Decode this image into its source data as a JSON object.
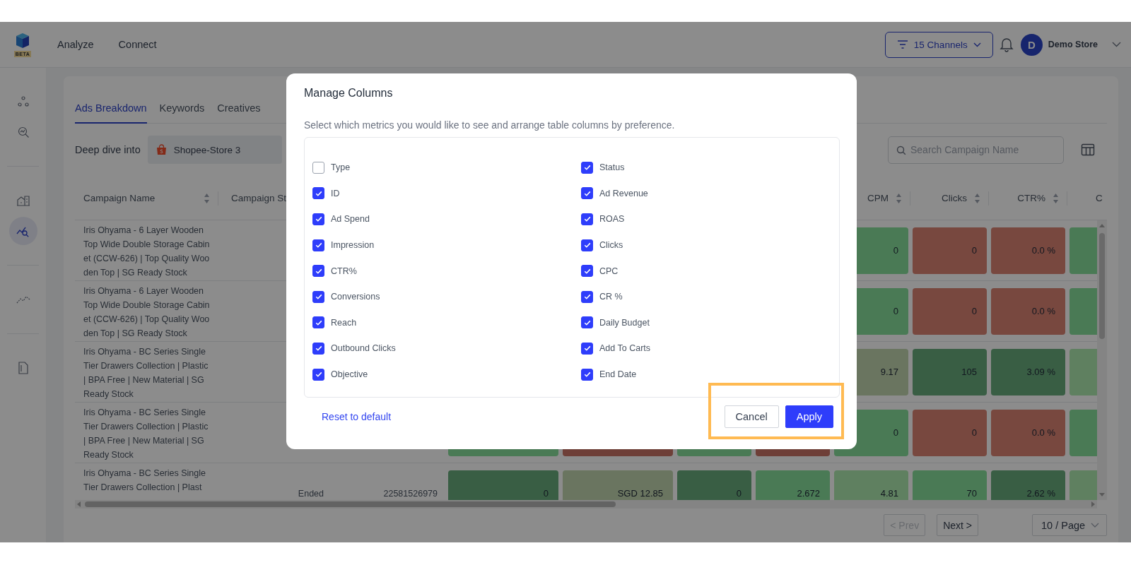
{
  "top_bar": {
    "logo_badge": "BETA",
    "nav": [
      {
        "label": "Analyze"
      },
      {
        "label": "Connect"
      }
    ],
    "channels_button": "15 Channels",
    "user": {
      "avatar": "D",
      "name": "Demo Store"
    }
  },
  "sidebar": {
    "groups": [
      {
        "items": [
          {
            "selected": false
          },
          {
            "selected": false
          }
        ]
      },
      {
        "items": [
          {
            "selected": false
          },
          {
            "selected": true
          }
        ]
      },
      {
        "items": [
          {
            "selected": false
          }
        ]
      },
      {
        "items": [
          {
            "selected": false
          }
        ]
      }
    ]
  },
  "tabs": [
    {
      "label": "Ads Breakdown",
      "selected": true
    },
    {
      "label": "Keywords",
      "selected": false
    },
    {
      "label": "Creatives",
      "selected": false
    }
  ],
  "filters": {
    "label": "Deep dive into",
    "store": "Shopee-Store 3",
    "search": {
      "placeholder": "Search Campaign Name"
    }
  },
  "table": {
    "columns": [
      "Campaign Name",
      "Campaign St",
      null,
      null,
      null,
      null,
      null,
      "CPM",
      "Clicks",
      "CTR%",
      "C"
    ],
    "rows": [
      {
        "name": "Iris Ohyama - 6 Layer Wooden Top Wide Double Storage Cabinet (CCW-626) | Top Quality Wooden Top | SG Ready Stock",
        "cells": [
          null,
          null,
          null,
          null,
          {
            "value": "0",
            "color": "#4a7a56"
          },
          {
            "value": "0",
            "color": "#784840"
          },
          {
            "value": "0.0 %",
            "color": "#784840"
          },
          {
            "color": "#4a7a56"
          }
        ]
      },
      {
        "name": "Iris Ohyama - 6 Layer Wooden Top Wide Double Storage Cabinet (CCW-626) | Top Quality Wooden Top | SG Ready Stock",
        "cells": [
          null,
          null,
          null,
          null,
          {
            "value": "0",
            "color": "#4a7a56"
          },
          {
            "value": "0",
            "color": "#784840"
          },
          {
            "value": "0.0 %",
            "color": "#784840"
          },
          {
            "color": "#4a7a56"
          }
        ]
      },
      {
        "name": "Iris Ohyama - BC Series Single Tier Drawers Collection | Plastic | BPA Free | New Material | SG Ready Stock",
        "cells": [
          null,
          null,
          null,
          null,
          {
            "value": "9.17",
            "color": "#6a7560"
          },
          {
            "value": "105",
            "color": "#3a5e45"
          },
          {
            "value": "3.09 %",
            "color": "#3a5e45"
          },
          {
            "color": "#5f8060"
          }
        ]
      },
      {
        "name": "Iris Ohyama - BC Series Single Tier Drawers Collection | Plastic | BPA Free | New Material | SG Ready Stock",
        "cells": [
          {
            "color": "#4a7a56"
          },
          {
            "color": "#6e3f38"
          },
          {
            "color": "#4a7a56"
          },
          {
            "color": "#6e3f38"
          },
          {
            "value": "0",
            "color": "#4a7a56"
          },
          {
            "value": "0",
            "color": "#784840"
          },
          {
            "value": "0.0 %",
            "color": "#784840"
          },
          {
            "color": "#4a7a56"
          }
        ]
      },
      {
        "name": "Iris Ohyama - BC Series Single Tier Drawers Collection | Plast",
        "status": "Ended",
        "id": "22581526979",
        "cells": [
          {
            "value": "0",
            "color": "#3a5e45"
          },
          {
            "value": "SGD 12.85",
            "color": "#6a7560"
          },
          {
            "value": "0",
            "color": "#3a5e45"
          },
          {
            "value": "2.672",
            "color": "#4a7a56"
          },
          {
            "value": "4.81",
            "color": "#5f8060"
          },
          {
            "value": "70",
            "color": "#4a7a56"
          },
          {
            "value": "2.62 %",
            "color": "#3a5e45"
          },
          {
            "color": "#5f8060"
          }
        ]
      }
    ]
  },
  "pagination": {
    "prev": {
      "label": "< Prev",
      "disabled": true
    },
    "next": {
      "label": "Next >",
      "disabled": false
    },
    "page_size": "10 / Page"
  },
  "dialog": {
    "title": "Manage Columns",
    "description": "Select which metrics you would like to see and arrange table columns by preference.",
    "options": [
      {
        "label": "Type",
        "checked": false
      },
      {
        "label": "Status",
        "checked": true
      },
      {
        "label": "ID",
        "checked": true
      },
      {
        "label": "Ad Revenue",
        "checked": true
      },
      {
        "label": "Ad Spend",
        "checked": true
      },
      {
        "label": "ROAS",
        "checked": true
      },
      {
        "label": "Impression",
        "checked": true
      },
      {
        "label": "Clicks",
        "checked": true
      },
      {
        "label": "CTR%",
        "checked": true
      },
      {
        "label": "CPC",
        "checked": true
      },
      {
        "label": "Conversions",
        "checked": true
      },
      {
        "label": "CR %",
        "checked": true
      },
      {
        "label": "Reach",
        "checked": true
      },
      {
        "label": "Daily Budget",
        "checked": true
      },
      {
        "label": "Outbound Clicks",
        "checked": true
      },
      {
        "label": "Add To Carts",
        "checked": true
      },
      {
        "label": "Objective",
        "checked": true
      },
      {
        "label": "End Date",
        "checked": true
      }
    ],
    "reset_link": "Reset to default",
    "buttons": [
      {
        "label": "Cancel",
        "kind": "secondary"
      },
      {
        "label": "Apply",
        "kind": "primary"
      }
    ],
    "buttons_highlighted": true
  }
}
